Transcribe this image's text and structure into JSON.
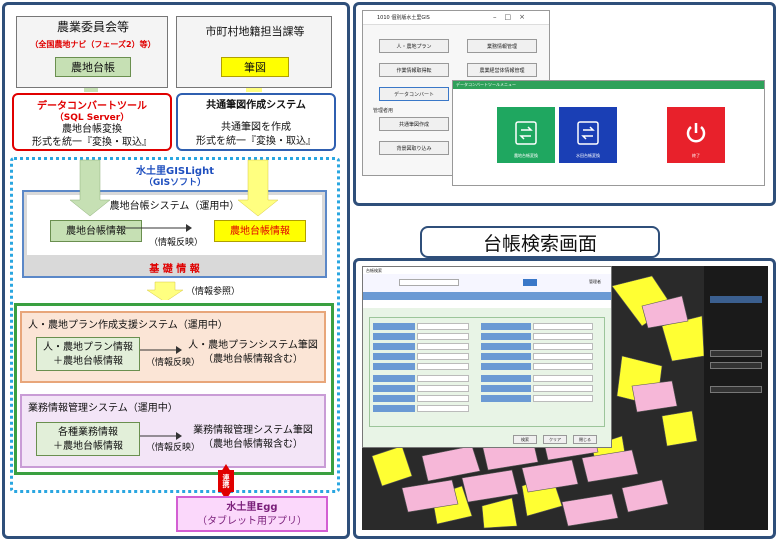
{
  "left": {
    "top_left_box": {
      "title": "農業委員会等",
      "subtitle": "（全国農地ナビ（フェーズ2）等）",
      "item": "農地台帳"
    },
    "top_right_box": {
      "title": "市町村地籍担当課等",
      "item": "筆図"
    },
    "convert_tool": {
      "title": "データコンバートツール",
      "subtitle": "（SQL Server）",
      "line1": "農地台帳変換",
      "line2": "形式を統一『変換・取込』"
    },
    "shared_system": {
      "title": "共通筆図作成システム",
      "line1": "共通筆図を作成",
      "line2": "形式を統一『変換・取込』"
    },
    "gislight": {
      "title": "水土里GISLight",
      "subtitle": "（GISソフト）"
    },
    "base": {
      "system_title": "農地台帳システム（運用中）",
      "ledger_info": "農地台帳情報",
      "reflect": "（情報反映）",
      "ledger_info_red": "農地台帳情報",
      "base_label": "基 礎 情 報"
    },
    "reference": "（情報参照）",
    "plan_system": {
      "title": "人・農地プラン作成支援システム（運用中）",
      "info_line1": "人・農地プラン情報",
      "info_line2": "＋農地台帳情報",
      "reflect": "（情報反映）",
      "result_line1": "人・農地プランシステム筆図",
      "result_line2": "（農地台帳情報含む）"
    },
    "business_system": {
      "title": "業務情報管理システム（運用中）",
      "info_line1": "各種業務情報",
      "info_line2": "＋農地台帳情報",
      "reflect": "（情報反映）",
      "result_line1": "業務情報管理システム筆図",
      "result_line2": "（農地台帳情報含む）"
    },
    "link_label": "連携",
    "egg": {
      "title": "水土里Egg",
      "subtitle": "（タブレット用アプリ）"
    }
  },
  "menu_screen": {
    "window_title": "1010 個別版水土里GIS",
    "buttons": [
      "人・農地プラン",
      "業務情報管理",
      "作業情報取得転",
      "農業経営体情報管理",
      "データコンバート",
      "共通筆図作成",
      "背景図取り込み"
    ],
    "admin_label": "管理者用",
    "converter_title": "データコンバートツールメニュー",
    "tiles": [
      "農地台帳変換",
      "水田台帳変換",
      "終了"
    ]
  },
  "search": {
    "title": "台帳検索画面",
    "window_title": "台帳検索",
    "admin_label": "管理者",
    "buttons": [
      "検索",
      "クリア",
      "閉じる"
    ]
  },
  "colors": {
    "frame": "#2f4f7a",
    "green": "#c6e0b4",
    "yellow": "#ffff00",
    "red_text": "#e00000",
    "tile_green": "#1fa760",
    "tile_blue": "#1a3fb5",
    "tile_red": "#e8212b"
  }
}
